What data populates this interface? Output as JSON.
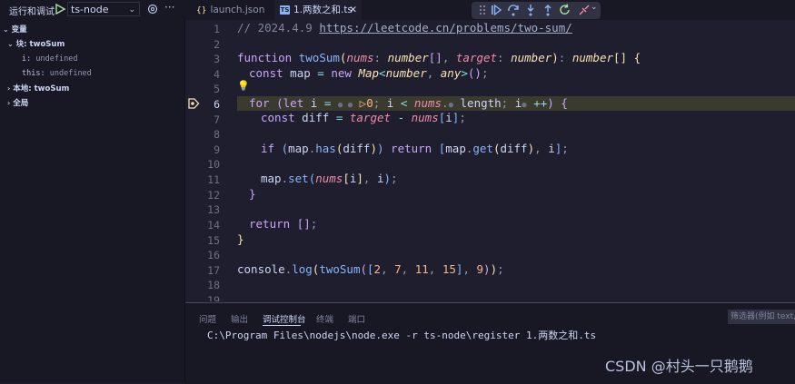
{
  "titlebar": {
    "run_and_debug_label": "运行和调试",
    "launch_config": "ts-node",
    "more_label": "···"
  },
  "tabs": [
    {
      "label": "launch.json",
      "icon": "json-braces-icon"
    },
    {
      "label": "1.两数之和.ts",
      "icon": "typescript-icon",
      "badge": "TS",
      "close": "✕"
    }
  ],
  "sidebar": {
    "variables_header": "变量",
    "block_scope": "块: twoSum",
    "vars": [
      {
        "name": "i",
        "value": "undefined"
      },
      {
        "name": "this",
        "value": "undefined"
      }
    ],
    "local_scope": "本地: twoSum",
    "global_scope": "全局"
  },
  "editor": {
    "line_numbers": [
      "1",
      "2",
      "3",
      "4",
      "5",
      "6",
      "7",
      "8",
      "9",
      "10",
      "11",
      "12",
      "13",
      "14",
      "15",
      "16",
      "17",
      "18",
      "19"
    ],
    "current_line": 6,
    "comment_date": "// 2024.4.9 ",
    "comment_url": "https://leetcode.cn/problems/two-sum/"
  },
  "panel": {
    "tabs": [
      "问题",
      "输出",
      "调试控制台",
      "终端",
      "端口"
    ],
    "active_tab": "调试控制台",
    "filter_placeholder": "筛选器(例如 text,",
    "console_output": "C:\\Program Files\\nodejs\\node.exe -r ts-node\\register 1.两数之和.ts"
  },
  "watermark": "CSDN @村头一只鹅鹅",
  "colors": {
    "background": "#1e1e2e",
    "sidebar": "#181825",
    "keyword": "#cba6f7",
    "function": "#89b4fa",
    "param": "#f38ba8",
    "type": "#f9e2af",
    "number": "#fab387",
    "breakpoint": "#f9e2af"
  }
}
